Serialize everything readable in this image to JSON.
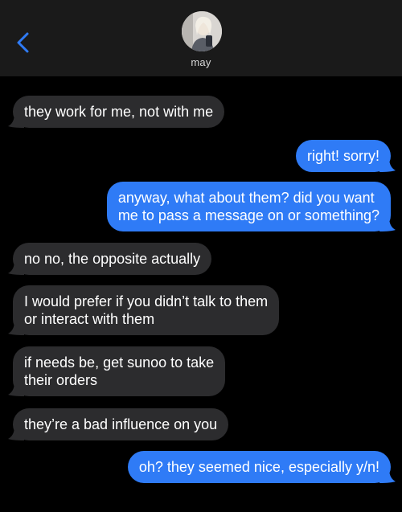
{
  "header": {
    "contact_name": "may",
    "back_icon": "chevron-left-icon",
    "avatar_icon": "contact-avatar",
    "accent_color": "#2f7bf6"
  },
  "messages": [
    {
      "direction": "incoming",
      "text": "they work for me, not with me"
    },
    {
      "direction": "outgoing",
      "text": "right! sorry!"
    },
    {
      "direction": "outgoing",
      "line1": "anyway, what about them? did you want",
      "line2": "me to pass a message on or something?"
    },
    {
      "direction": "incoming",
      "text": "no no, the opposite actually"
    },
    {
      "direction": "incoming",
      "line1": "I would prefer if you didn’t talk to them",
      "line2": "or interact with them"
    },
    {
      "direction": "incoming",
      "line1": "if needs be, get sunoo to take",
      "line2": "their orders"
    },
    {
      "direction": "incoming",
      "text": "they’re a bad influence on you"
    },
    {
      "direction": "outgoing",
      "text": "oh? they seemed nice, especially y/n!"
    }
  ],
  "colors": {
    "incoming_bubble": "#2c2c2e",
    "outgoing_bubble": "#2f7bf6",
    "header_bg": "#1a1a1a",
    "background": "#000000"
  }
}
